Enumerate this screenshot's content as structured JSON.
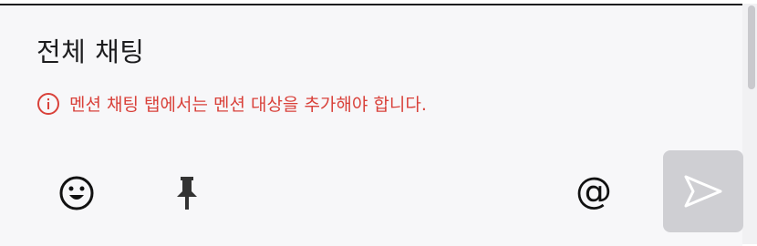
{
  "chat": {
    "title": "전체 채팅",
    "warning": "멘션 채팅 탭에서는 멘션 대상을 추가해야 합니다."
  },
  "toolbar": {
    "emoji_icon": "smile-icon",
    "pin_icon": "pin-icon",
    "mention_icon": "at-sign-icon",
    "mention_glyph": "@",
    "send_icon": "send-icon"
  },
  "colors": {
    "warning": "#d9413a",
    "send_disabled_bg": "#cfcfd3",
    "panel_bg": "#f7f7f9"
  }
}
